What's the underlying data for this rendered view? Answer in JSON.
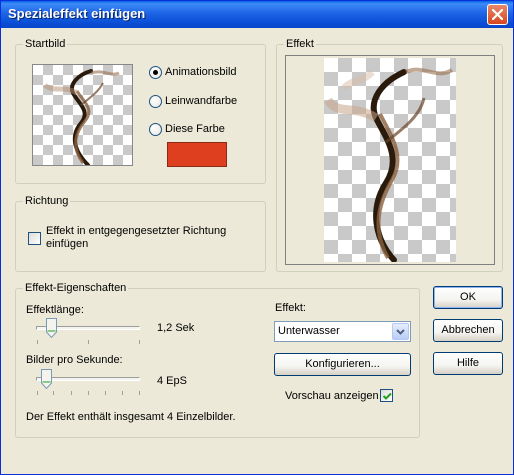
{
  "window": {
    "title": "Spezialeffekt einfügen"
  },
  "startbild": {
    "label": "Startbild",
    "options": [
      "Animationsbild",
      "Leinwandfarbe",
      "Diese Farbe"
    ],
    "selected_index": 0,
    "color": "#DE3F1F"
  },
  "effekt_preview": {
    "label": "Effekt"
  },
  "richtung": {
    "label": "Richtung",
    "checkbox_label_line1": "Effekt in entgegengesetzter Richtung",
    "checkbox_label_line2": "einfügen",
    "checked": false
  },
  "eigenschaften": {
    "label": "Effekt-Eigenschaften",
    "length_label": "Effektlänge:",
    "length_value": "1,2 Sek",
    "fps_label": "Bilder pro Sekunde:",
    "fps_value": "4 EpS",
    "summary": "Der Effekt enthält insgesamt 4 Einzelbilder.",
    "effect_label": "Effekt:",
    "effect_selected": "Unterwasser",
    "configure_label": "Konfigurieren...",
    "preview_label": "Vorschau anzeigen",
    "preview_checked": true
  },
  "buttons": {
    "ok": "OK",
    "cancel": "Abbrechen",
    "help": "Hilfe"
  },
  "icons": {
    "close": "close-icon",
    "dropdown": "chevron-down-icon",
    "check": "check-icon"
  },
  "colors": {
    "titlebar": "#0A4FD6",
    "dialog_bg": "#ECE9D8",
    "swatch": "#DE3F1F"
  }
}
